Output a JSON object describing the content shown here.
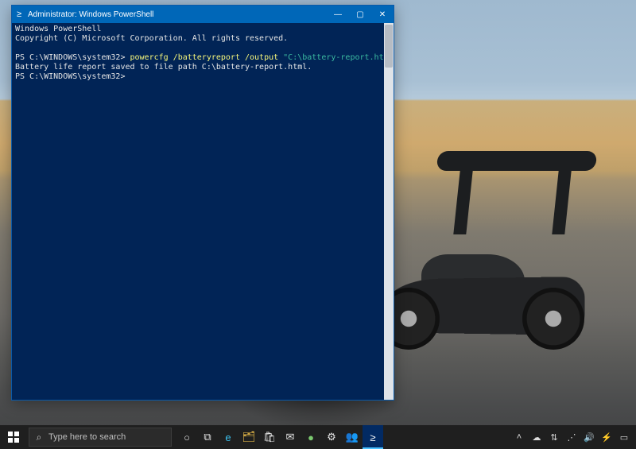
{
  "window": {
    "title": "Administrator: Windows PowerShell",
    "buttons": {
      "min": "—",
      "max": "▢",
      "close": "✕"
    }
  },
  "terminal": {
    "l1": "Windows PowerShell",
    "l2": "Copyright (C) Microsoft Corporation. All rights reserved.",
    "blank1": " ",
    "prompt1_pre": "PS C:\\WINDOWS\\system32> ",
    "prompt1_cmd": "powercfg /batteryreport /output ",
    "prompt1_str": "\"C:\\battery-report.html\"",
    "l4": "Battery life report saved to file path C:\\battery-report.html.",
    "prompt2": "PS C:\\WINDOWS\\system32>",
    "blank2": " "
  },
  "taskbar": {
    "search_placeholder": "Type here to search",
    "icons": {
      "start": "start-icon",
      "search": "search-icon",
      "cortana": "○",
      "taskview": "⧉",
      "edge": "e",
      "explorer": "🗂",
      "store": "🛍",
      "mail": "✉",
      "app1": "●",
      "settings": "⚙",
      "teams": "👥",
      "powershell": "≥"
    },
    "tray": {
      "up": "˄",
      "onedrive": "☁",
      "net": "⇅",
      "wifi": "⋰",
      "sound": "🔊",
      "power": "⚡",
      "notif": "▭"
    }
  }
}
